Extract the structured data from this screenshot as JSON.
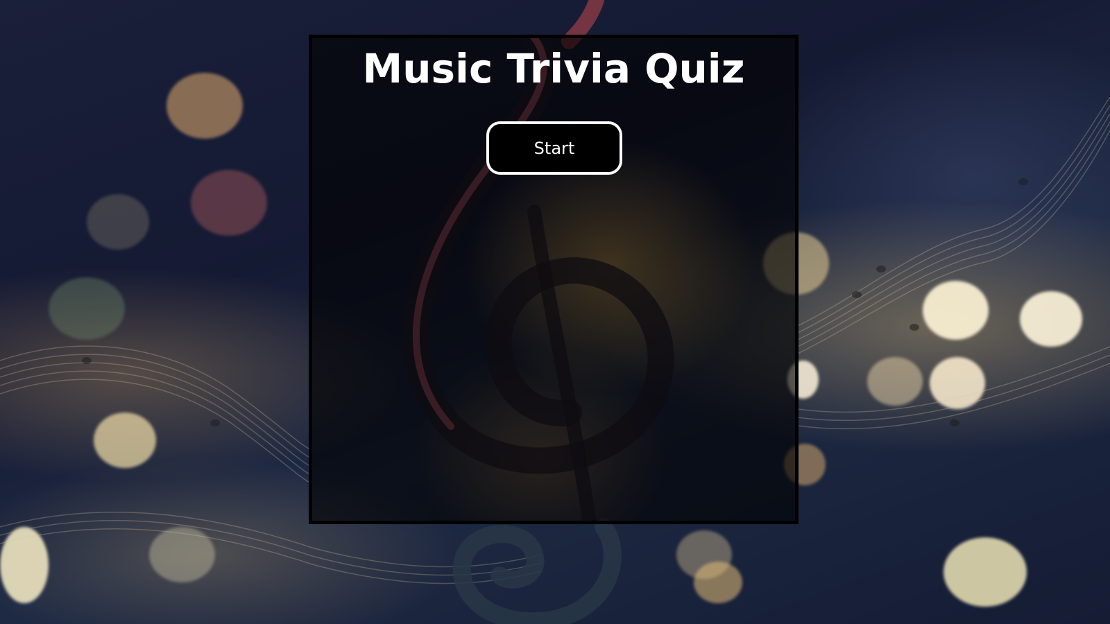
{
  "quiz": {
    "title": "Music Trivia Quiz",
    "start_label": "Start"
  },
  "background": {
    "theme": "music-bokeh-treble-clef",
    "icon": "treble-clef-icon"
  },
  "colors": {
    "panel_border": "#000000",
    "title_text": "#ffffff",
    "button_bg": "#000000",
    "button_border": "#ffffff",
    "button_text": "#ffffff"
  }
}
